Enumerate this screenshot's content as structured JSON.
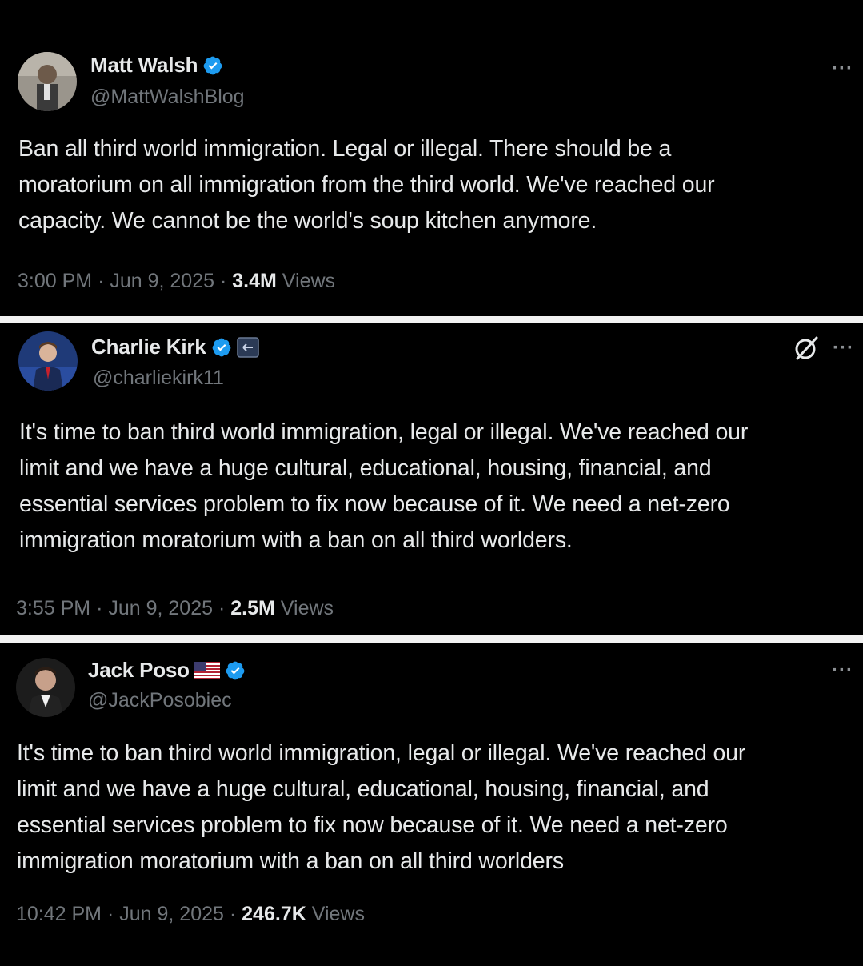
{
  "tweets": [
    {
      "display_name": "Matt Walsh",
      "handle": "@MattWalshBlog",
      "text": "Ban all third world immigration. Legal or illegal. There should be a\nmoratorium on all immigration from the third world. We've reached our\ncapacity. We cannot be the world's soup kitchen anymore.",
      "time": "3:00 PM",
      "date": "Jun 9, 2025",
      "views_count": "3.4M",
      "views_label": "Views",
      "sep": "·"
    },
    {
      "display_name": "Charlie Kirk",
      "handle": "@charliekirk11",
      "text": "It's time to ban third world immigration, legal or illegal. We've reached our\nlimit and we have a huge cultural, educational, housing, financial, and\nessential services problem to fix now because of it. We need a net-zero\nimmigration moratorium with a ban on all third worlders.",
      "time": "3:55 PM",
      "date": "Jun 9, 2025",
      "views_count": "2.5M",
      "views_label": "Views",
      "sep": "·"
    },
    {
      "display_name": "Jack Poso",
      "handle": "@JackPosobiec",
      "text": "It's time to ban third world immigration, legal or illegal. We've reached our\nlimit and we have a huge cultural, educational, housing, financial, and\nessential services problem to fix now because of it. We need a net-zero\nimmigration moratorium with a ban on all third worlders",
      "time": "10:42 PM",
      "date": "Jun 9, 2025",
      "views_count": "246.7K",
      "views_label": "Views",
      "sep": "·"
    }
  ],
  "icons": {
    "more": "more-horizontal-icon",
    "verified": "verified-badge-icon",
    "grok": "grok-icon",
    "flag": "us-flag-icon",
    "affiliate": "affiliate-badge-icon"
  },
  "colors": {
    "background": "#000000",
    "text": "#e7e9ea",
    "secondary": "#71767b",
    "verified": "#1d9bf0",
    "divider": "#f2f2f2"
  },
  "more_glyph": "···"
}
